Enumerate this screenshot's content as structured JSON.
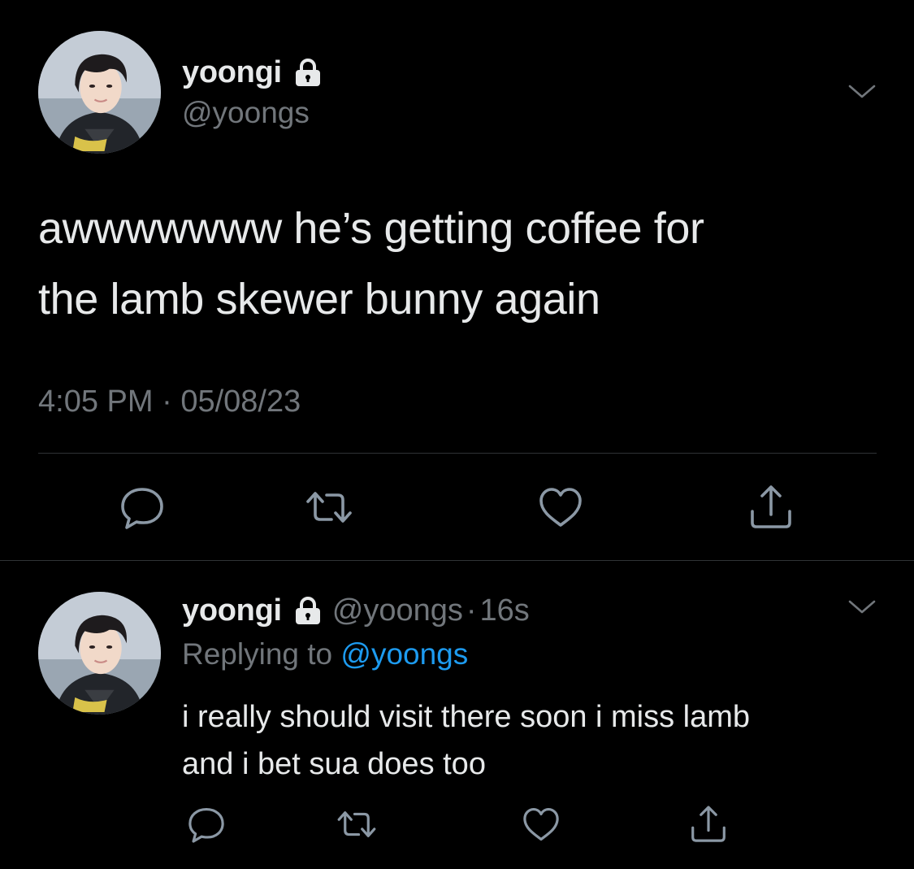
{
  "main_tweet": {
    "display_name": "yoongi",
    "handle": "@yoongs",
    "text_line1": "awwwwwww he’s getting coffee for",
    "text_line2": "the lamb skewer bunny again",
    "time": "4:05 PM",
    "separator": " · ",
    "date": "05/08/23",
    "icons": {
      "avatar": "profile-photo",
      "lock": "lock-icon",
      "more": "chevron-down-icon",
      "reply": "reply-icon",
      "retweet": "retweet-icon",
      "like": "heart-icon",
      "share": "share-icon"
    }
  },
  "reply_tweet": {
    "display_name": "yoongi",
    "handle": "@yoongs",
    "separator": "·",
    "time_ago": "16s",
    "replying_to_label": "Replying to ",
    "replying_to_handle": "@yoongs",
    "text_line1": "i really should visit there soon i miss lamb",
    "text_line2": "and i bet sua does too"
  },
  "colors": {
    "background": "#000000",
    "primary_text": "#e7e9ea",
    "secondary_text": "#71767b",
    "accent": "#1d9bf0",
    "divider": "#2f3336",
    "icon": "#8b98a5"
  }
}
